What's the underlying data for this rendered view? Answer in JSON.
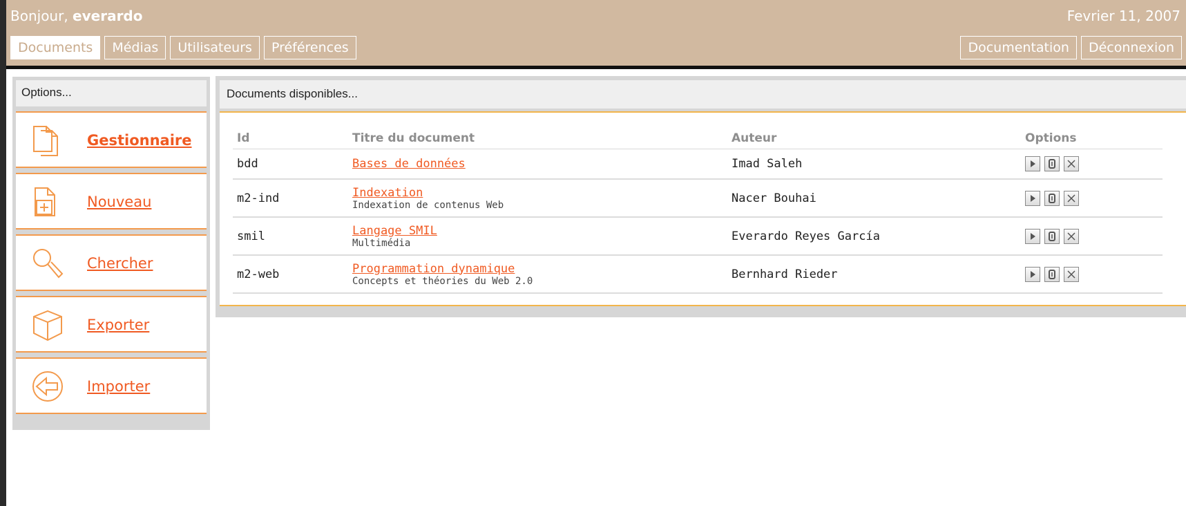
{
  "header": {
    "greeting_prefix": "Bonjour,",
    "username": "everardo",
    "date": "Fevrier 11, 2007"
  },
  "nav": {
    "tabs": [
      "Documents",
      "Médias",
      "Utilisateurs",
      "Préférences"
    ],
    "active_tab": "Documents",
    "right_tabs": [
      "Documentation",
      "Déconnexion"
    ]
  },
  "sidebar": {
    "heading": "Options...",
    "items": [
      {
        "label": "Gestionnaire",
        "icon": "documents-icon"
      },
      {
        "label": "Nouveau",
        "icon": "new-document-icon"
      },
      {
        "label": "Chercher",
        "icon": "magnifier-icon"
      },
      {
        "label": "Exporter",
        "icon": "box-icon"
      },
      {
        "label": "Importer",
        "icon": "import-arrow-icon"
      }
    ]
  },
  "main": {
    "heading": "Documents disponibles...",
    "columns": {
      "id": "Id",
      "title": "Titre du document",
      "author": "Auteur",
      "options": "Options"
    },
    "rows": [
      {
        "id": "bdd",
        "title": "Bases de données",
        "subtitle": "",
        "author": "Imad Saleh"
      },
      {
        "id": "m2-ind",
        "title": "Indexation",
        "subtitle": "Indexation de contenus Web",
        "author": "Nacer Bouhai"
      },
      {
        "id": "smil",
        "title": "Langage SMIL",
        "subtitle": "Multimédia",
        "author": "Everardo Reyes García"
      },
      {
        "id": "m2-web",
        "title": "Programmation dynamique",
        "subtitle": "Concepts et théories du Web 2.0",
        "author": "Bernhard Rieder"
      }
    ],
    "row_option_icons": [
      "play-icon",
      "edit-icon",
      "delete-icon"
    ]
  },
  "colors": {
    "header_bg": "#d1b9a0",
    "accent": "#f05a22",
    "rule_orange": "#f39a4c",
    "panel_gray": "#d6d6d6"
  }
}
